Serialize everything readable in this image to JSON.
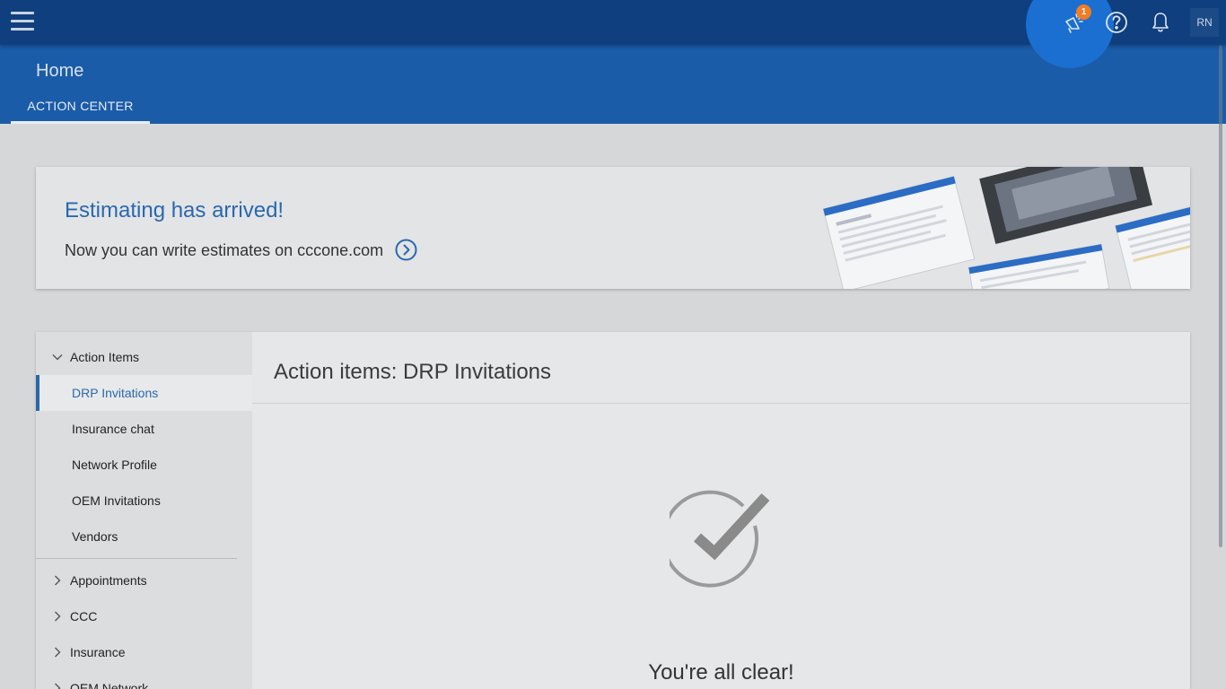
{
  "topbar": {
    "menu_icon": "hamburger-menu-icon",
    "whats_new_icon": "megaphone-icon",
    "whats_new_badge": "1",
    "help_icon": "help-circle-icon",
    "notifications_icon": "bell-icon",
    "avatar_initials": "RN"
  },
  "header": {
    "title": "Home",
    "tab_label": "ACTION CENTER"
  },
  "banner": {
    "title": "Estimating has arrived!",
    "text": "Now you can write estimates on cccone.com",
    "arrow_icon": "chevron-right-circle-icon"
  },
  "sidebar": {
    "groups": [
      {
        "label": "Action Items",
        "expanded": true
      },
      {
        "label": "Appointments",
        "expanded": false
      },
      {
        "label": "CCC",
        "expanded": false
      },
      {
        "label": "Insurance",
        "expanded": false
      },
      {
        "label": "OEM Network",
        "expanded": false
      }
    ],
    "items": [
      {
        "label": "DRP Invitations",
        "active": true
      },
      {
        "label": "Insurance chat",
        "active": false
      },
      {
        "label": "Network Profile",
        "active": false
      },
      {
        "label": "OEM Invitations",
        "active": false
      },
      {
        "label": "Vendors",
        "active": false
      }
    ]
  },
  "content": {
    "title": "Action items: DRP Invitations",
    "empty_icon": "check-circle-icon",
    "empty_message": "You're all clear!"
  },
  "colors": {
    "topbar": "#0f3f7e",
    "header": "#1b5ca8",
    "accent": "#2a68ad",
    "badge": "#f07c24"
  }
}
